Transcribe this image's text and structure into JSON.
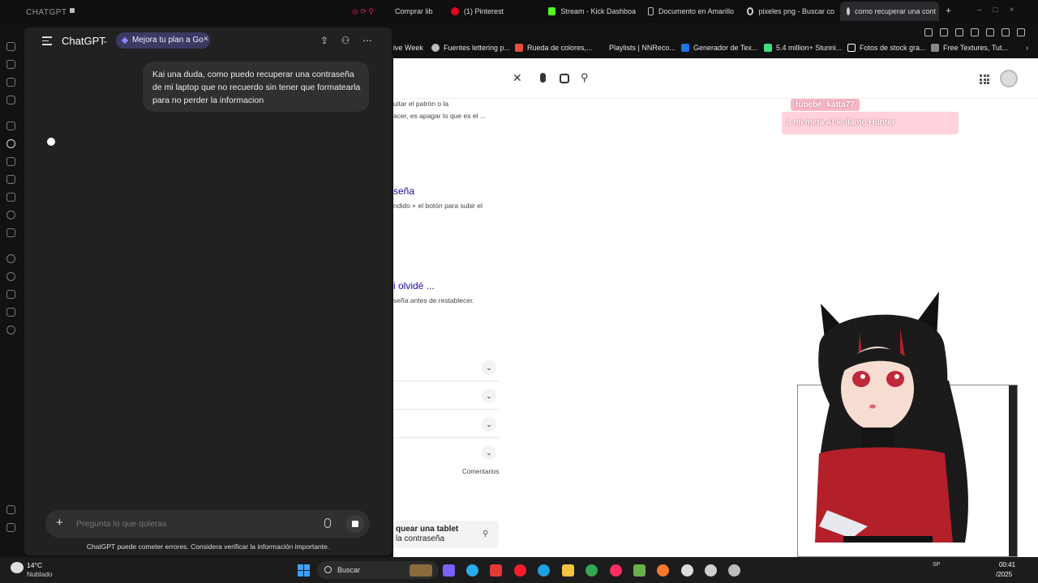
{
  "browser": {
    "tabs": [
      {
        "label": "Comprar lib",
        "color": "#e0245e"
      },
      {
        "label": "(1) Pinterest",
        "color": "#e60023"
      },
      {
        "label": "Stream - Kick Dashboa",
        "color": "#53fc18"
      },
      {
        "label": "Documento en Amarillo",
        "color": "#bbbbbb"
      },
      {
        "label": "pixeles png - Buscar co",
        "color": "#cccccc"
      },
      {
        "label": "como recuperar una cont",
        "color": "#cccccc"
      }
    ],
    "new_tab": "+",
    "bookmarks": [
      {
        "label": "ive Week",
        "color": "#666666"
      },
      {
        "label": "Fuentes lettering p...",
        "color": "#bbbbbb"
      },
      {
        "label": "Rueda de colores,...",
        "color": "#e74c3c"
      },
      {
        "label": "Playlists | NNReco...",
        "color": "#111111"
      },
      {
        "label": "Generador de Tex...",
        "color": "#1a73e8"
      },
      {
        "label": "5.4 million+ Stunni...",
        "color": "#3ddc84"
      },
      {
        "label": "Fotos de stock gra...",
        "color": "#ffffff"
      },
      {
        "label": "Free Textures, Tut...",
        "color": "#888888"
      }
    ]
  },
  "chatgpt": {
    "window_title": "CHATGPT",
    "app_name": "ChatGPT",
    "upgrade_pill": "Mejora tu plan a Go",
    "upgrade_close": "×",
    "user_message": "Kai una duda, como puedo recuperar una contraseña de mi laptop que no recuerdo sin tener que formatearla para no perder la informacion",
    "composer_placeholder": "Pregunta lo que quieras",
    "disclaimer": "ChatGPT puede cometer errores. Considera verificar la información importante.",
    "header_icons": [
      "share-icon",
      "person-add-icon",
      "more-icon"
    ]
  },
  "google": {
    "snippet_1a": "uitar el patrón o la",
    "snippet_1b": "acer, es apagar lo que es el ...",
    "link_2": "seña",
    "snippet_2": "ndido + el botón para subir el",
    "link_3": "i olvidé ...",
    "snippet_3": "seña antes de restablecer.",
    "paa_chevron": "⌄",
    "comments": "Comentarios",
    "related_search_line1": "quear una tablet",
    "related_search_line2": "la contraseña"
  },
  "stream_overlay": {
    "chat_username": "tubebe_katta77",
    "chat_message": "a mi meta AI le llamo Hunter"
  },
  "taskbar": {
    "weather_temp": "14°C",
    "weather_desc": "Nublado",
    "search_label": "Buscar",
    "language": "SP",
    "time": "00:41",
    "date": "/2025",
    "apps": [
      {
        "name": "copilot",
        "color": "#7b61ff"
      },
      {
        "name": "telegram",
        "color": "#2aabee"
      },
      {
        "name": "app-red",
        "color": "#e53935"
      },
      {
        "name": "opera",
        "color": "#ff1b2d"
      },
      {
        "name": "edge",
        "color": "#1ba0e2"
      },
      {
        "name": "explorer",
        "color": "#f5c242"
      },
      {
        "name": "chrome",
        "color": "#34a853"
      },
      {
        "name": "app-pink",
        "color": "#ff2e63"
      },
      {
        "name": "notepad",
        "color": "#6ab04c"
      },
      {
        "name": "blender",
        "color": "#f5792a"
      },
      {
        "name": "obs",
        "color": "#dddddd"
      },
      {
        "name": "davinci",
        "color": "#d0d0d0"
      },
      {
        "name": "settings",
        "color": "#bbbbbb"
      }
    ]
  }
}
